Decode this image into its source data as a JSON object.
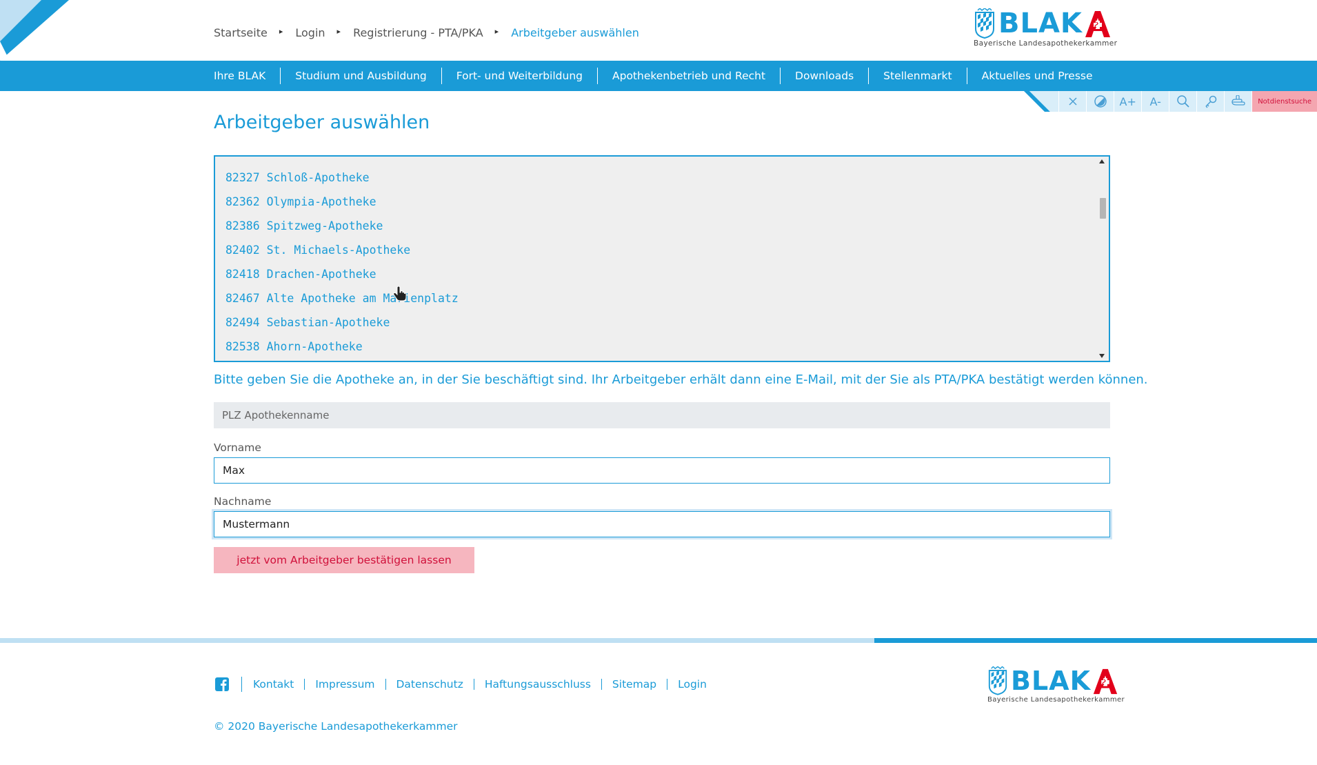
{
  "breadcrumb": {
    "items": [
      "Startseite",
      "Login",
      "Registrierung - PTA/PKA",
      "Arbeitgeber auswählen"
    ],
    "separator": "▸"
  },
  "logo": {
    "wordmark": "BLAK",
    "subtitle": "Bayerische  Landesapothekerkammer"
  },
  "nav": {
    "items": [
      "Ihre BLAK",
      "Studium und Ausbildung",
      "Fort- und Weiterbildung",
      "Apothekenbetrieb und Recht",
      "Downloads",
      "Stellenmarkt",
      "Aktuelles und Presse"
    ]
  },
  "a11y": {
    "buttons": [
      "close-icon",
      "contrast-icon",
      "font-increase-icon",
      "font-decrease-icon",
      "search-icon",
      "key-icon",
      "hand-icon"
    ],
    "font_increase_label": "A+",
    "font_decrease_label": "A-",
    "notdienst_label": "Notdienstsuche"
  },
  "page": {
    "title": "Arbeitgeber auswählen"
  },
  "pharmacy_list": {
    "items": [
      "82327 Schloß-Apotheke",
      "82362 Olympia-Apotheke",
      "82386 Spitzweg-Apotheke",
      "82402 St. Michaels-Apotheke",
      "82418 Drachen-Apotheke",
      "82467 Alte Apotheke am Marienplatz",
      "82494 Sebastian-Apotheke",
      "82538 Ahorn-Apotheke"
    ]
  },
  "form": {
    "help_text": "Bitte geben Sie die Apotheke an, in der Sie beschäftigt sind. Ihr Arbeitgeber erhält dann eine E-Mail, mit der Sie als PTA/PKA bestätigt werden können.",
    "plz_placeholder": "PLZ Apothekenname",
    "vorname_label": "Vorname",
    "vorname_value": "Max",
    "nachname_label": "Nachname",
    "nachname_value": "Mustermann",
    "submit_label": "jetzt vom Arbeitgeber bestätigen lassen"
  },
  "footer": {
    "links": [
      "Kontakt",
      "Impressum",
      "Datenschutz",
      "Haftungsausschluss",
      "Sitemap",
      "Login"
    ],
    "copyright": "© 2020 Bayerische Landesapothekerkammer"
  },
  "colors": {
    "brand_blue": "#1a9bd7",
    "light_blue": "#bfe0f3",
    "pink": "#f6b6bf",
    "red": "#d0103a"
  }
}
